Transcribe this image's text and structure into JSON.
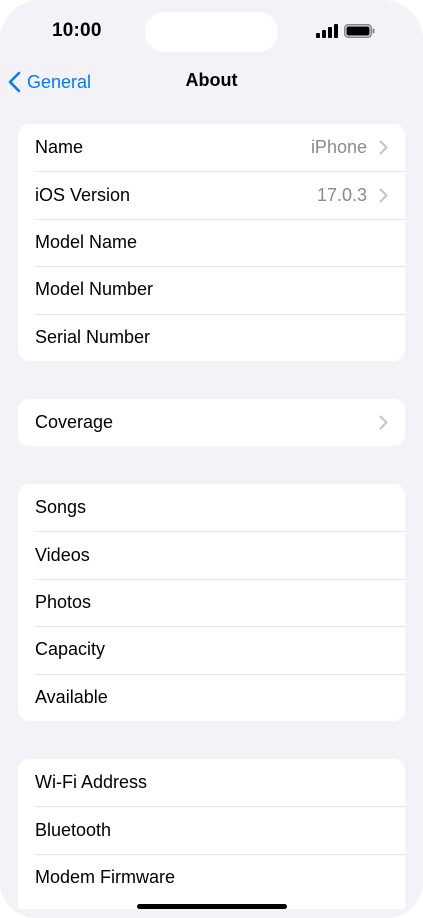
{
  "status_bar": {
    "time": "10:00",
    "signal_icon": "cellular-signal-icon",
    "battery_icon": "battery-icon"
  },
  "nav": {
    "back_label": "General",
    "title": "About",
    "back_icon": "chevron-left-icon"
  },
  "colors": {
    "accent": "#007aff",
    "background": "#f2f2f7",
    "secondary_text": "#8a8a8e"
  },
  "groups": [
    {
      "rows": [
        {
          "label": "Name",
          "value": "iPhone",
          "chevron": true
        },
        {
          "label": "iOS Version",
          "value": "17.0.3",
          "chevron": true
        },
        {
          "label": "Model Name"
        },
        {
          "label": "Model Number"
        },
        {
          "label": "Serial Number"
        }
      ]
    },
    {
      "rows": [
        {
          "label": "Coverage",
          "chevron": true
        }
      ]
    },
    {
      "rows": [
        {
          "label": "Songs"
        },
        {
          "label": "Videos"
        },
        {
          "label": "Photos"
        },
        {
          "label": "Capacity"
        },
        {
          "label": "Available"
        }
      ]
    },
    {
      "rows": [
        {
          "label": "Wi-Fi Address"
        },
        {
          "label": "Bluetooth"
        },
        {
          "label": "Modem Firmware"
        }
      ]
    }
  ]
}
